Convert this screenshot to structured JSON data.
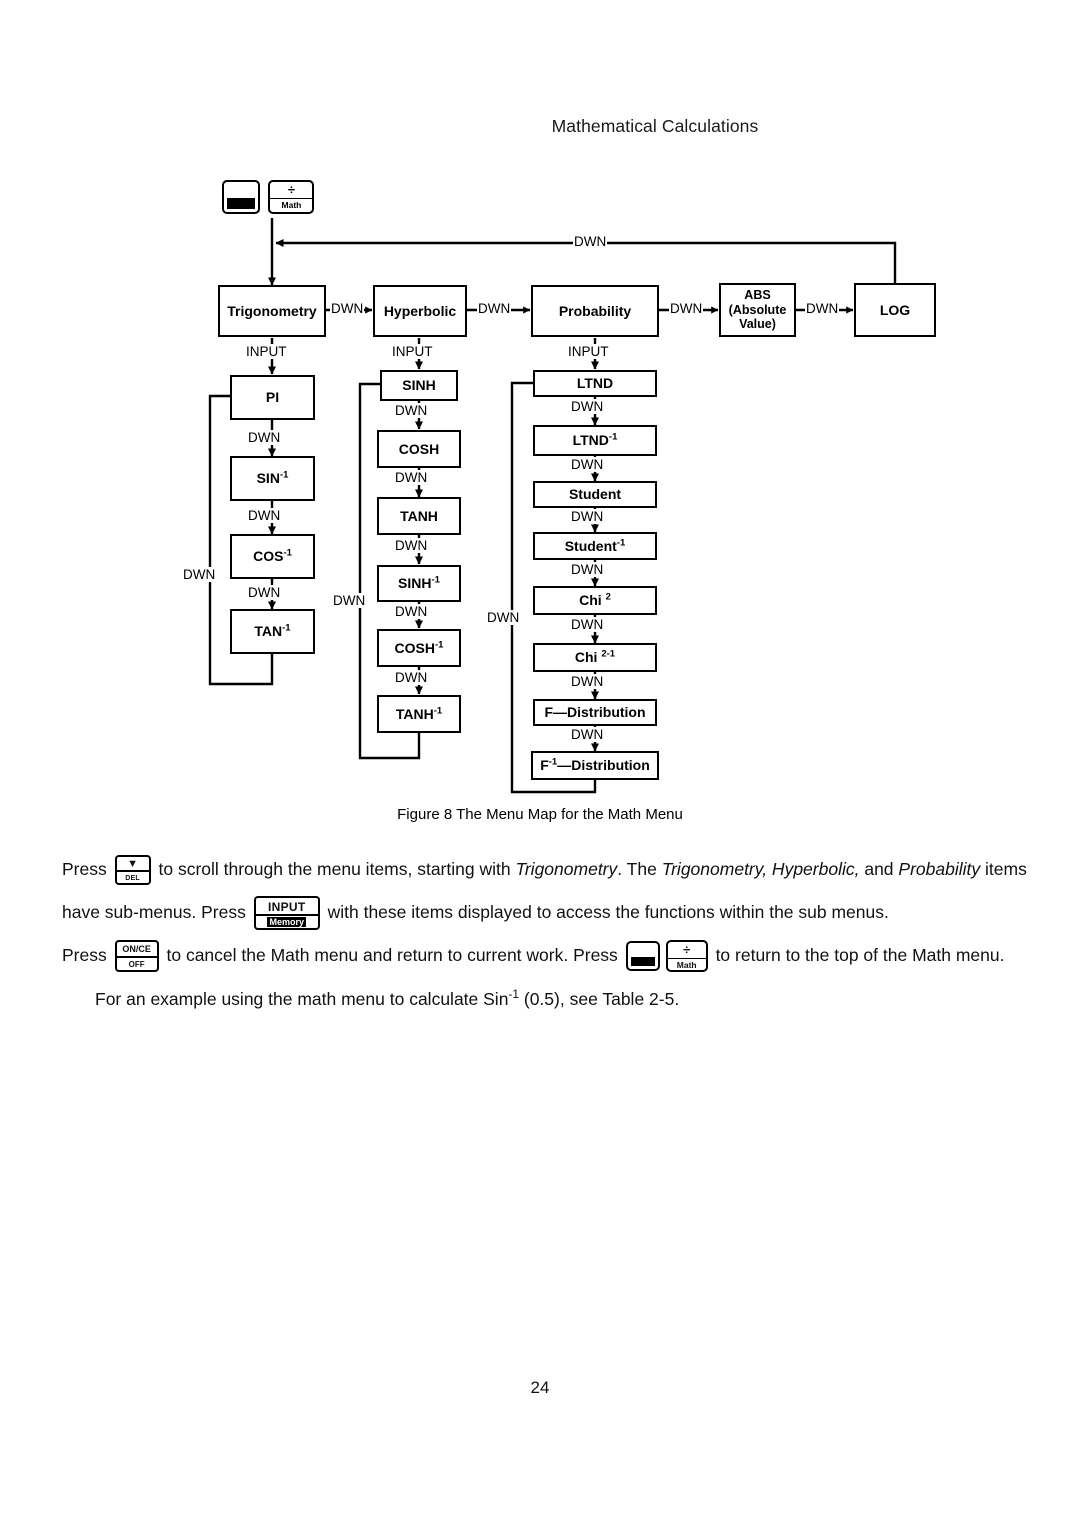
{
  "header": {
    "running_head": "Mathematical Calculations"
  },
  "figure": {
    "caption": "Figure 8 The Menu Map for the Math Menu",
    "top_keys": {
      "shift_label": "",
      "math_top": "÷",
      "math_bottom": "Math"
    },
    "top_row": [
      {
        "id": "trigonometry",
        "label": "Trigonometry"
      },
      {
        "id": "hyperbolic",
        "label": "Hyperbolic"
      },
      {
        "id": "probability",
        "label": "Probability"
      },
      {
        "id": "abs",
        "label": "ABS (Absolute Value)",
        "line1": "ABS",
        "line2": "(Absolute",
        "line3": "Value)"
      },
      {
        "id": "log",
        "label": "LOG"
      }
    ],
    "edge_labels": {
      "dwn": "DWN",
      "input": "INPUT"
    },
    "trig_submenu": [
      {
        "id": "pi",
        "label": "PI",
        "sup": ""
      },
      {
        "id": "sin-inv",
        "label": "SIN",
        "sup": "-1"
      },
      {
        "id": "cos-inv",
        "label": "COS",
        "sup": "-1"
      },
      {
        "id": "tan-inv",
        "label": "TAN",
        "sup": "-1"
      }
    ],
    "hyperbolic_submenu": [
      {
        "id": "sinh",
        "label": "SINH",
        "sup": ""
      },
      {
        "id": "cosh",
        "label": "COSH",
        "sup": ""
      },
      {
        "id": "tanh",
        "label": "TANH",
        "sup": ""
      },
      {
        "id": "sinh-inv",
        "label": "SINH",
        "sup": "-1"
      },
      {
        "id": "cosh-inv",
        "label": "COSH",
        "sup": "-1"
      },
      {
        "id": "tanh-inv",
        "label": "TANH",
        "sup": "-1"
      }
    ],
    "probability_submenu": [
      {
        "id": "ltnd",
        "label": "LTND",
        "sup": ""
      },
      {
        "id": "ltnd-inv",
        "label": "LTND",
        "sup": "-1"
      },
      {
        "id": "student",
        "label": "Student",
        "sup": ""
      },
      {
        "id": "student-inv",
        "label": "Student",
        "sup": "-1"
      },
      {
        "id": "chi2",
        "label": "Chi ",
        "sup": "2"
      },
      {
        "id": "chi2-inv",
        "label": "Chi ",
        "sup": "2-1"
      },
      {
        "id": "f-distribution",
        "label": "F—Distribution",
        "sup": ""
      },
      {
        "id": "f-inv-distribution",
        "label": "F",
        "sup": "-1",
        "label_after": "—Distribution"
      }
    ]
  },
  "body": {
    "para1_a": "Press",
    "para1_b": "to scroll through the menu items, starting with",
    "para1_trig": "Trigonometry",
    "para1_c": ". The",
    "para1_list": "Trigonometry, Hyperbolic,",
    "para1_d": "and",
    "para1_prob": "Probability",
    "para1_e": "items have sub-menus. Press",
    "para1_f": "with these items displayed to access the functions within the sub menus.",
    "para2_a": "Press",
    "para2_b": "to cancel the Math menu and return to current work. Press",
    "para2_c": "to return to the top of the Math menu.",
    "para3_a": "For an example using the math menu to calculate Sin",
    "para3_sup": "-1",
    "para3_b": "(0.5), see Table 2-5."
  },
  "keys": {
    "del": {
      "arrow": "▼",
      "label": "DEL"
    },
    "input": {
      "top": "INPUT",
      "bottom": "Memory"
    },
    "onoff": {
      "top": "ON/CE",
      "bottom": "OFF"
    },
    "math": {
      "top": "÷",
      "bottom": "Math"
    }
  },
  "footer": {
    "page_number": "24"
  },
  "colors": {
    "ink": "#000000",
    "paper": "#ffffff",
    "header_text": "#1a1a1a"
  }
}
